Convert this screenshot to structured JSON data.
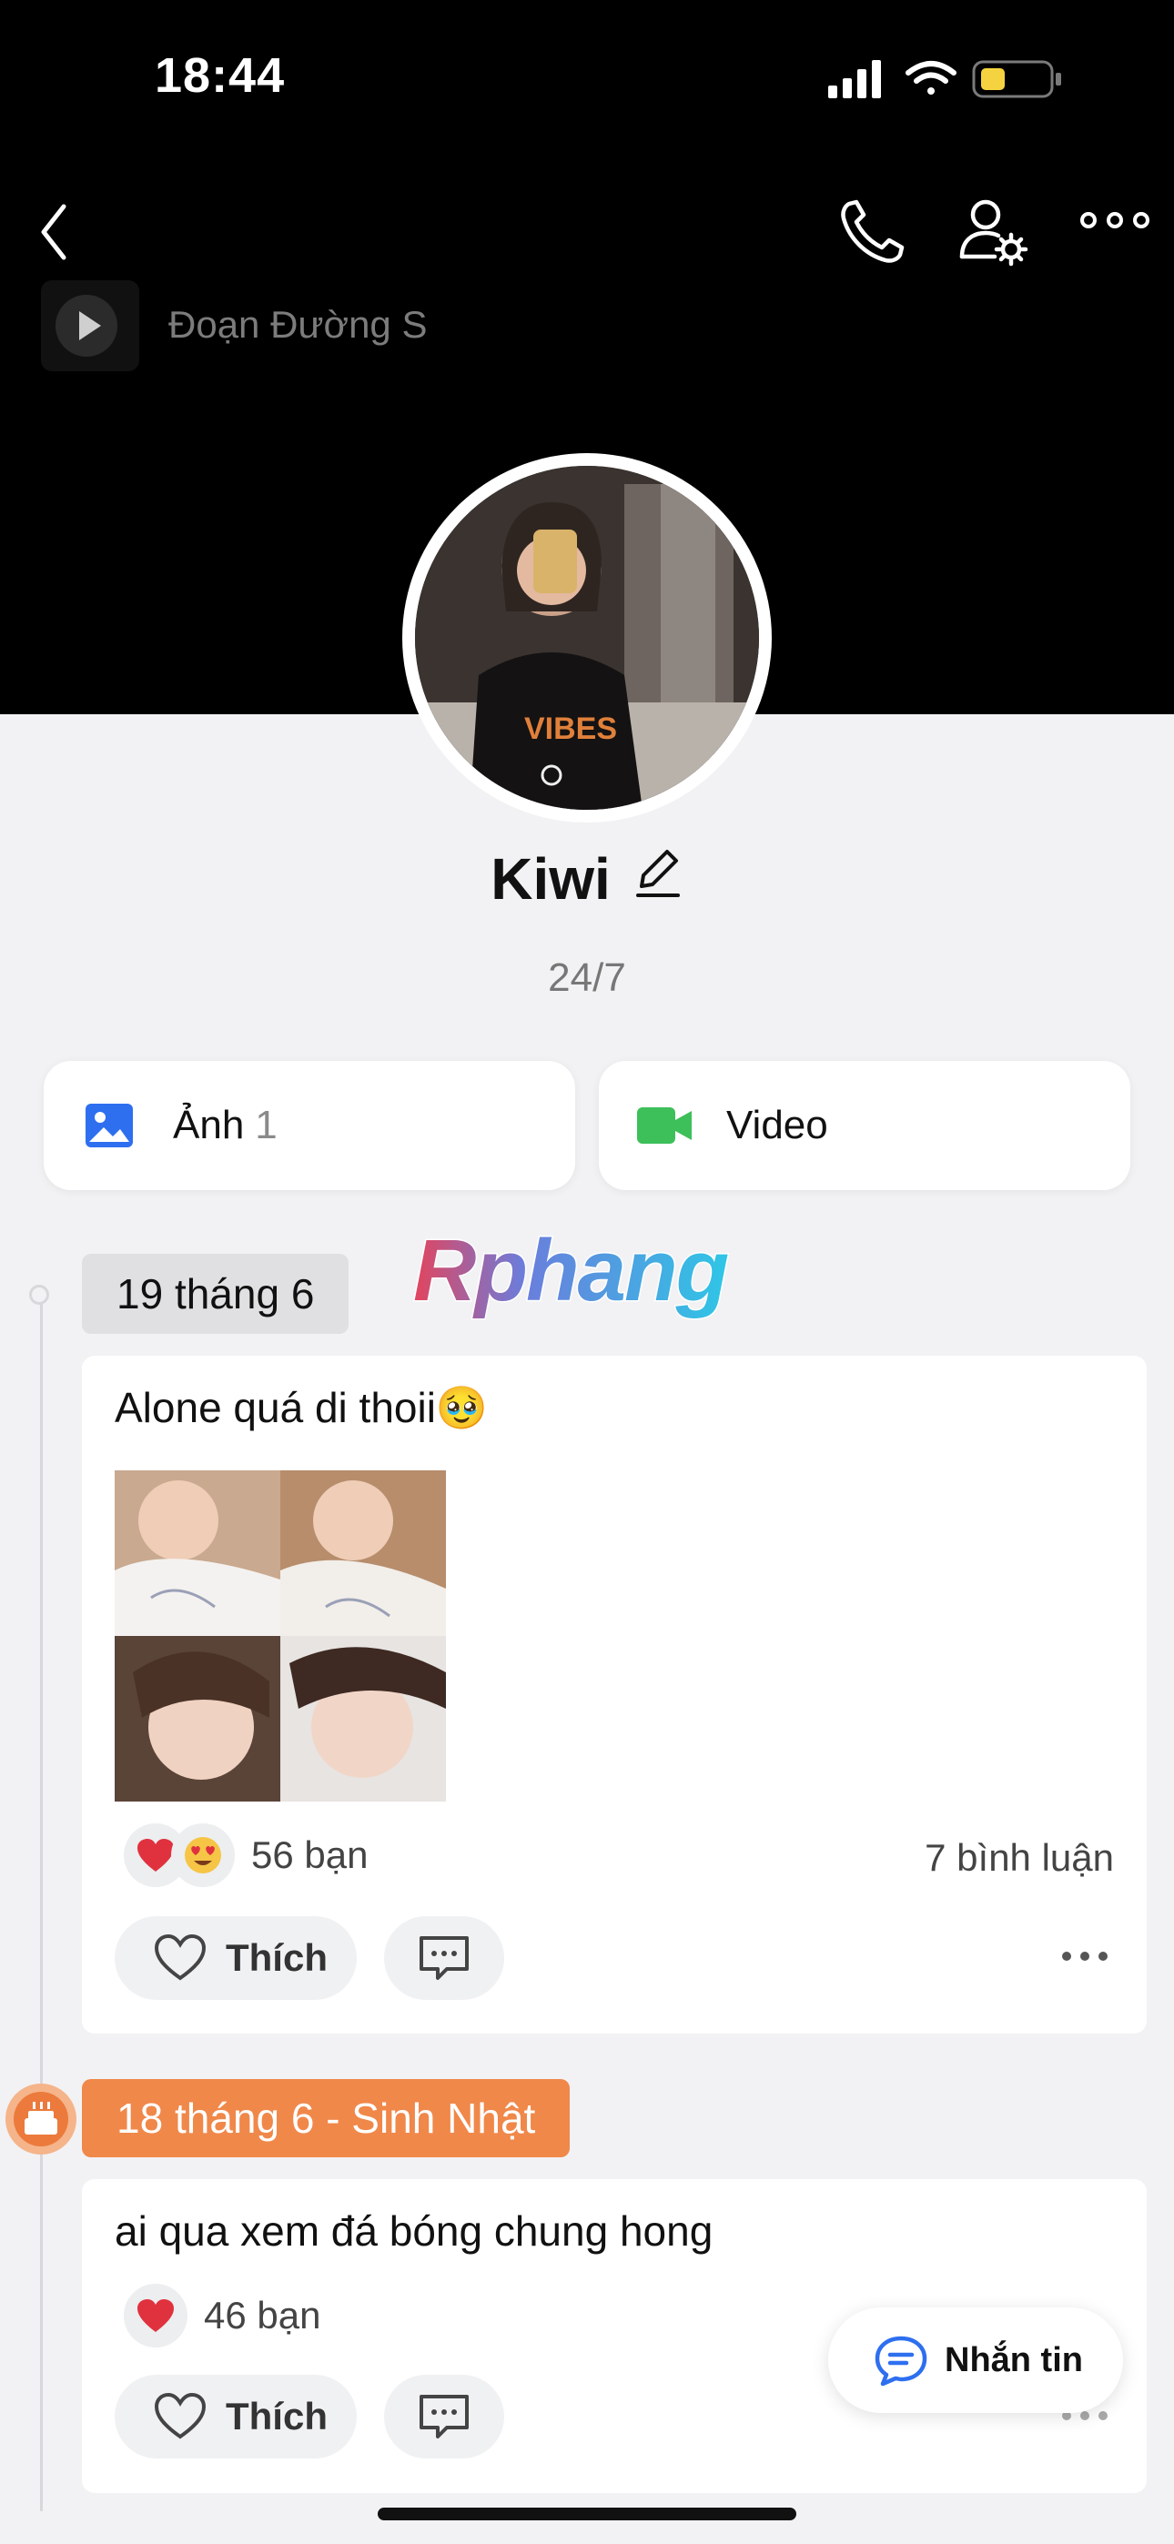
{
  "status_bar": {
    "time": "18:44"
  },
  "header": {
    "music_title": "Đoạn Đường S",
    "icons": [
      "back-icon",
      "phone-icon",
      "user-settings-icon",
      "more-icon"
    ]
  },
  "profile": {
    "name": "Kiwi",
    "status": "24/7"
  },
  "media": {
    "photos_label": "Ảnh",
    "photos_count": "1",
    "videos_label": "Video"
  },
  "watermark": "Rphang",
  "timeline": [
    {
      "date": "19 tháng 6",
      "text": "Alone quá di thoii🥹",
      "reactions_count": "56 bạn",
      "comments": "7 bình luận",
      "like_label": "Thích"
    },
    {
      "date": "18 tháng 6 - Sinh Nhật",
      "text": "ai qua xem đá bóng chung hong",
      "reactions_count": "46 bạn",
      "like_label": "Thích"
    }
  ],
  "floating": {
    "message_label": "Nhắn tin"
  },
  "colors": {
    "accent_orange": "#f0884a",
    "accent_blue": "#2e6ff0",
    "video_green": "#3dbf5a"
  }
}
